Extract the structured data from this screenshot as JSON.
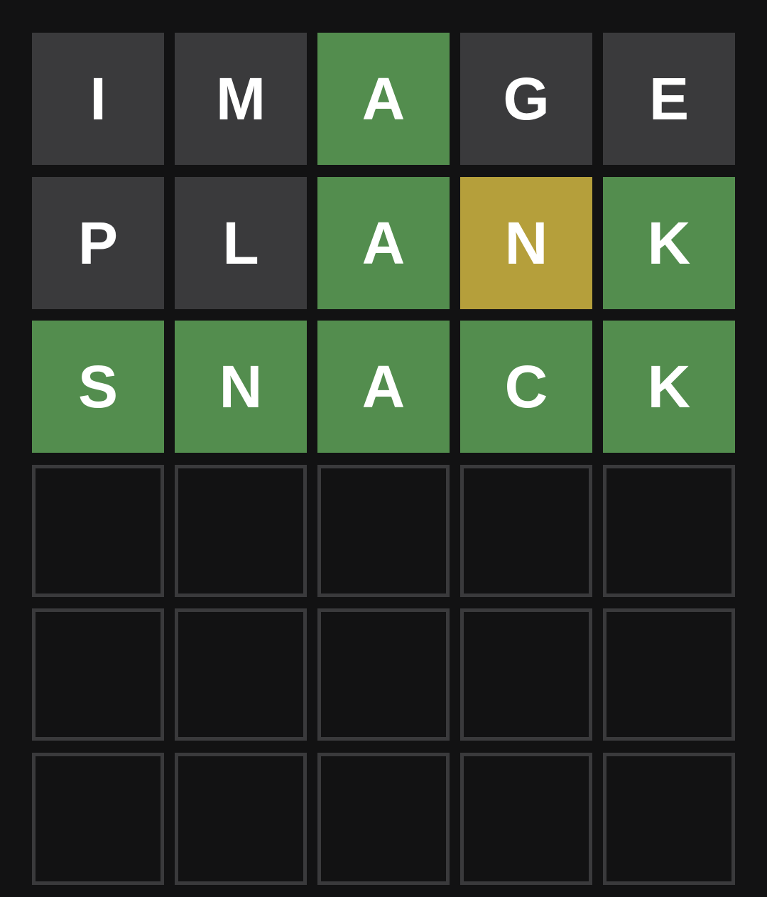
{
  "colors": {
    "background": "#121213",
    "absent": "#3a3a3c",
    "present": "#b59f3b",
    "correct": "#538d4e",
    "empty_border": "#3a3a3c",
    "letter": "#ffffff"
  },
  "board": {
    "rows": [
      {
        "tiles": [
          {
            "letter": "I",
            "state": "absent"
          },
          {
            "letter": "M",
            "state": "absent"
          },
          {
            "letter": "A",
            "state": "correct"
          },
          {
            "letter": "G",
            "state": "absent"
          },
          {
            "letter": "E",
            "state": "absent"
          }
        ]
      },
      {
        "tiles": [
          {
            "letter": "P",
            "state": "absent"
          },
          {
            "letter": "L",
            "state": "absent"
          },
          {
            "letter": "A",
            "state": "correct"
          },
          {
            "letter": "N",
            "state": "present"
          },
          {
            "letter": "K",
            "state": "correct"
          }
        ]
      },
      {
        "tiles": [
          {
            "letter": "S",
            "state": "correct"
          },
          {
            "letter": "N",
            "state": "correct"
          },
          {
            "letter": "A",
            "state": "correct"
          },
          {
            "letter": "C",
            "state": "correct"
          },
          {
            "letter": "K",
            "state": "correct"
          }
        ]
      },
      {
        "tiles": [
          {
            "letter": "",
            "state": "empty"
          },
          {
            "letter": "",
            "state": "empty"
          },
          {
            "letter": "",
            "state": "empty"
          },
          {
            "letter": "",
            "state": "empty"
          },
          {
            "letter": "",
            "state": "empty"
          }
        ]
      },
      {
        "tiles": [
          {
            "letter": "",
            "state": "empty"
          },
          {
            "letter": "",
            "state": "empty"
          },
          {
            "letter": "",
            "state": "empty"
          },
          {
            "letter": "",
            "state": "empty"
          },
          {
            "letter": "",
            "state": "empty"
          }
        ]
      },
      {
        "tiles": [
          {
            "letter": "",
            "state": "empty"
          },
          {
            "letter": "",
            "state": "empty"
          },
          {
            "letter": "",
            "state": "empty"
          },
          {
            "letter": "",
            "state": "empty"
          },
          {
            "letter": "",
            "state": "empty"
          }
        ]
      }
    ]
  }
}
